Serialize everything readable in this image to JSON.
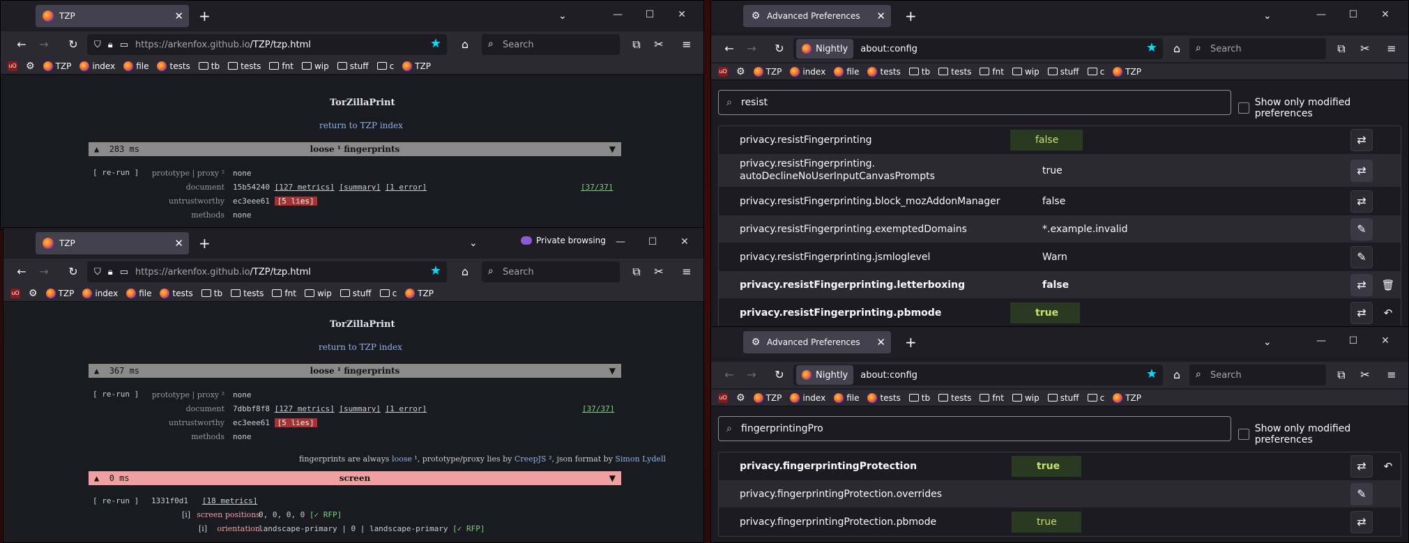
{
  "common": {
    "bookmarks": [
      "TZP",
      "index",
      "file",
      "tests",
      "tb",
      "tests",
      "fnt",
      "wip",
      "stuff",
      "c",
      "TZP"
    ],
    "search_placeholder": "Search"
  },
  "win1": {
    "tab_title": "TZP",
    "url_host": "https://arkenfox.github.io",
    "url_path": "/TZP/tzp.html",
    "title": "TorZillaPrint",
    "link": "return to TZP index",
    "section": {
      "ms": "283 ms",
      "title": "loose ¹ fingerprints",
      "arrows": [
        "▲",
        "▼"
      ]
    },
    "rerun": "[ re-run ]",
    "rows": [
      {
        "label": "prototype | proxy ²",
        "value": "none"
      },
      {
        "label": "document",
        "value": "15b54240",
        "metrics": "[127 metrics]",
        "summary": "[summary]",
        "error": "[1 error]",
        "count": "[37/37]"
      },
      {
        "label": "untrustworthy",
        "value": "ec3eee61",
        "lies": "[5 lies]"
      },
      {
        "label": "methods",
        "value": "none"
      }
    ]
  },
  "win2": {
    "tab_title": "TZP",
    "private": "Private browsing",
    "url_host": "https://arkenfox.github.io",
    "url_path": "/TZP/tzp.html",
    "title": "TorZillaPrint",
    "link": "return to TZP index",
    "section": {
      "ms": "367 ms",
      "title": "loose ¹ fingerprints"
    },
    "rerun": "[ re-run ]",
    "rows": [
      {
        "label": "prototype | proxy ²",
        "value": "none"
      },
      {
        "label": "document",
        "value": "7dbbf8f8",
        "metrics": "[127 metrics]",
        "summary": "[summary]",
        "error": "[1 error]",
        "count": "[37/37]"
      },
      {
        "label": "untrustworthy",
        "value": "ec3eee61",
        "lies": "[5 lies]"
      },
      {
        "label": "methods",
        "value": "none"
      }
    ],
    "footer": {
      "a": "fingerprints are always ",
      "loose": "loose",
      "b": " ¹, prototype/proxy lies by ",
      "creep": "CreepJS",
      "c": " ², json format by ",
      "simon": "Simon Lydell"
    },
    "screen": {
      "ms": "0 ms",
      "title": "screen"
    },
    "screen_rerun": "[ re-run ]",
    "screen_hash": "1331f0d1",
    "screen_metrics": "[18 metrics]",
    "screen_rows": [
      {
        "label": "screen positions",
        "value": "0, 0, 0, 0 ",
        "rfp": "[✓ RFP]",
        "i": "[i]"
      },
      {
        "label": "orientation",
        "value": "landscape-primary | 0 | landscape-primary ",
        "rfp": "[✓ RFP]",
        "i": "[i]"
      }
    ]
  },
  "win3": {
    "tab_title": "Advanced Preferences",
    "nightly": "Nightly",
    "url": "about:config",
    "filter": "resist",
    "show_modified": "Show only modified preferences",
    "prefs": [
      {
        "name": "privacy.resistFingerprinting",
        "value": "false",
        "modified": true,
        "bold": false,
        "action": "⇄"
      },
      {
        "name": "privacy.resistFingerprinting.",
        "name2": "autoDeclineNoUserInputCanvasPrompts",
        "value": "true",
        "modified": false,
        "bold": false,
        "action": "⇄"
      },
      {
        "name": "privacy.resistFingerprinting.block_mozAddonManager",
        "value": "false",
        "modified": false,
        "bold": false,
        "action": "⇄"
      },
      {
        "name": "privacy.resistFingerprinting.exemptedDomains",
        "value": "*.example.invalid",
        "modified": false,
        "bold": false,
        "action": "✎"
      },
      {
        "name": "privacy.resistFingerprinting.jsmloglevel",
        "value": "Warn",
        "modified": false,
        "bold": false,
        "action": "✎"
      },
      {
        "name": "privacy.resistFingerprinting.letterboxing",
        "value": "false",
        "modified": false,
        "bold": true,
        "action": "⇄",
        "extra": "🗑"
      },
      {
        "name": "privacy.resistFingerprinting.pbmode",
        "value": "true",
        "modified": true,
        "bold": true,
        "action": "⇄",
        "extra": "↶"
      }
    ]
  },
  "win4": {
    "tab_title": "Advanced Preferences",
    "nightly": "Nightly",
    "url": "about:config",
    "filter": "fingerprintingPro",
    "show_modified": "Show only modified preferences",
    "prefs": [
      {
        "name": "privacy.fingerprintingProtection",
        "value": "true",
        "modified": true,
        "bold": true,
        "action": "⇄",
        "extra": "↶"
      },
      {
        "name": "privacy.fingerprintingProtection.overrides",
        "value": "",
        "modified": false,
        "bold": false,
        "action": "✎"
      },
      {
        "name": "privacy.fingerprintingProtection.pbmode",
        "value": "true",
        "modified": true,
        "bold": false,
        "action": "⇄"
      }
    ]
  }
}
